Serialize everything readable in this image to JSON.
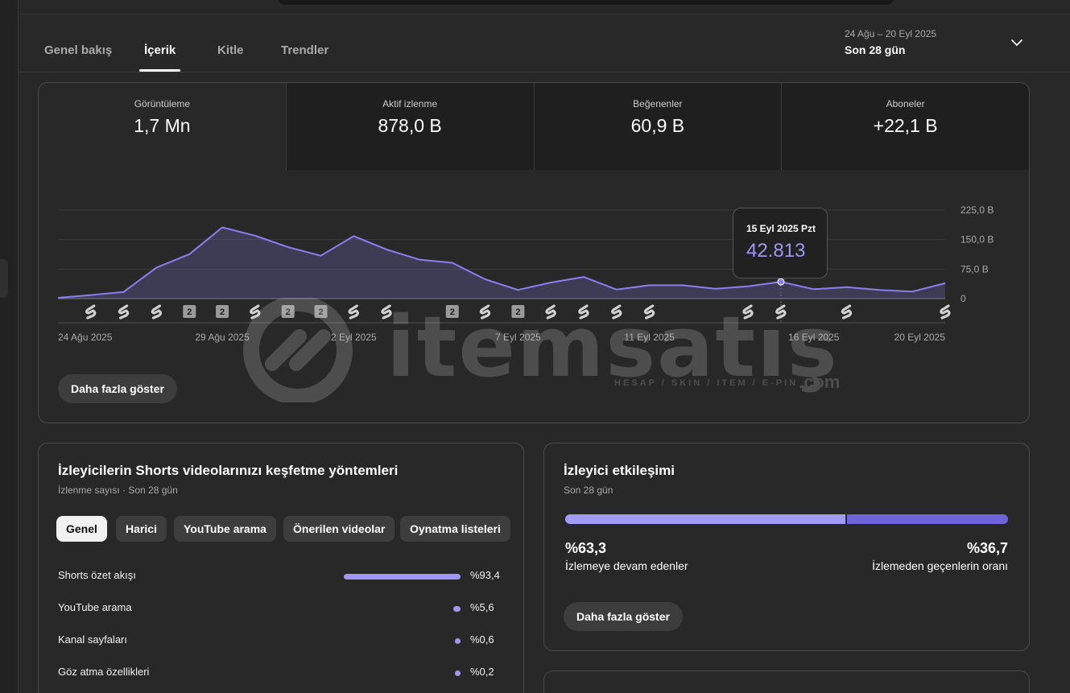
{
  "tabs": [
    {
      "label": "Genel bakış",
      "active": false
    },
    {
      "label": "İçerik",
      "active": true
    },
    {
      "label": "Kitle",
      "active": false
    },
    {
      "label": "Trendler",
      "active": false
    }
  ],
  "date_range": {
    "range": "24 Ağu – 20 Eyl 2025",
    "period": "Son 28 gün"
  },
  "metrics": [
    {
      "label": "Görüntüleme",
      "value": "1,7 Mn"
    },
    {
      "label": "Aktif izlenme",
      "value": "878,0 B"
    },
    {
      "label": "Beğenenler",
      "value": "60,9 B"
    },
    {
      "label": "Aboneler",
      "value": "+22,1 B"
    }
  ],
  "chart_data": {
    "type": "area",
    "x": [
      "24 Ağu 2025",
      "25 Ağu 2025",
      "26 Ağu 2025",
      "27 Ağu 2025",
      "28 Ağu 2025",
      "29 Ağu 2025",
      "30 Ağu 2025",
      "31 Ağu 2025",
      "1 Eyl 2025",
      "2 Eyl 2025",
      "3 Eyl 2025",
      "4 Eyl 2025",
      "5 Eyl 2025",
      "6 Eyl 2025",
      "7 Eyl 2025",
      "8 Eyl 2025",
      "9 Eyl 2025",
      "10 Eyl 2025",
      "11 Eyl 2025",
      "12 Eyl 2025",
      "13 Eyl 2025",
      "14 Eyl 2025",
      "15 Eyl 2025",
      "16 Eyl 2025",
      "17 Eyl 2025",
      "18 Eyl 2025",
      "19 Eyl 2025",
      "20 Eyl 2025"
    ],
    "values": [
      2000,
      9000,
      17000,
      79000,
      113000,
      181000,
      160000,
      131000,
      109000,
      159000,
      125000,
      99000,
      91000,
      49000,
      22000,
      41000,
      55000,
      23000,
      34000,
      34000,
      25000,
      31000,
      42813,
      24000,
      29000,
      22000,
      18000,
      39000
    ],
    "ylim": [
      0,
      225000
    ],
    "y_ticks": [
      {
        "value": 0,
        "label": "0"
      },
      {
        "value": 75000,
        "label": "75,0 B"
      },
      {
        "value": 150000,
        "label": "150,0 B"
      },
      {
        "value": 225000,
        "label": "225,0 B"
      }
    ],
    "x_tick_labels": [
      {
        "index": 0,
        "label": "24 Ağu 2025"
      },
      {
        "index": 5,
        "label": "29 Ağu 2025"
      },
      {
        "index": 9,
        "label": "2 Eyl 2025"
      },
      {
        "index": 14,
        "label": "7 Eyl 2025"
      },
      {
        "index": 18,
        "label": "11 Eyl 2025"
      },
      {
        "index": 23,
        "label": "16 Eyl 2025"
      },
      {
        "index": 27,
        "label": "20 Eyl 2025"
      }
    ],
    "markers": [
      {
        "index": 1,
        "kind": "shorts"
      },
      {
        "index": 2,
        "kind": "shorts"
      },
      {
        "index": 3,
        "kind": "shorts"
      },
      {
        "index": 4,
        "kind": "count",
        "label": "2"
      },
      {
        "index": 5,
        "kind": "count",
        "label": "2"
      },
      {
        "index": 6,
        "kind": "shorts"
      },
      {
        "index": 7,
        "kind": "count",
        "label": "2"
      },
      {
        "index": 8,
        "kind": "count",
        "label": "2"
      },
      {
        "index": 9,
        "kind": "shorts"
      },
      {
        "index": 10,
        "kind": "shorts"
      },
      {
        "index": 12,
        "kind": "count",
        "label": "2"
      },
      {
        "index": 13,
        "kind": "shorts"
      },
      {
        "index": 14,
        "kind": "count",
        "label": "2"
      },
      {
        "index": 15,
        "kind": "shorts"
      },
      {
        "index": 16,
        "kind": "shorts"
      },
      {
        "index": 17,
        "kind": "shorts"
      },
      {
        "index": 18,
        "kind": "shorts"
      },
      {
        "index": 21,
        "kind": "shorts"
      },
      {
        "index": 22,
        "kind": "shorts"
      },
      {
        "index": 24,
        "kind": "shorts"
      },
      {
        "index": 27,
        "kind": "shorts"
      }
    ],
    "highlight_index": 22,
    "color": "#8b7ff0",
    "grid": true
  },
  "tooltip": {
    "date": "15 Eyl 2025 Pzt",
    "value": "42.813"
  },
  "show_more_label": "Daha fazla göster",
  "discovery": {
    "title": "İzleyicilerin Shorts videolarınızı keşfetme yöntemleri",
    "subtitle": "İzlenme sayısı · Son 28 gün",
    "chips": [
      {
        "label": "Genel",
        "active": true
      },
      {
        "label": "Harici",
        "active": false
      },
      {
        "label": "YouTube arama",
        "active": false
      },
      {
        "label": "Önerilen videolar",
        "active": false
      },
      {
        "label": "Oynatma listeleri",
        "active": false
      }
    ],
    "rows": [
      {
        "name": "Shorts özet akışı",
        "pct": "%93,4",
        "value": 93.4
      },
      {
        "name": "YouTube arama",
        "pct": "%5,6",
        "value": 5.6
      },
      {
        "name": "Kanal sayfaları",
        "pct": "%0,6",
        "value": 0.6
      },
      {
        "name": "Göz atma özellikleri",
        "pct": "%0,2",
        "value": 0.2
      }
    ]
  },
  "engagement": {
    "title": "İzleyici etkileşimi",
    "subtitle": "Son 28 gün",
    "stayed_pct": "%63,3",
    "stayed_label": "İzlemeye devam edenler",
    "stayed_value": 63.3,
    "swiped_pct": "%36,7",
    "swiped_label": "İzlemeden geçenlerin oranı",
    "swiped_value": 36.7,
    "color_stayed": "#a29bf5",
    "color_swiped": "#6e63d8"
  },
  "watermark": {
    "brand": "itemsatış",
    "tagline": "HESAP / SKIN / ITEM / E-PIN",
    "suffix": ".com"
  }
}
